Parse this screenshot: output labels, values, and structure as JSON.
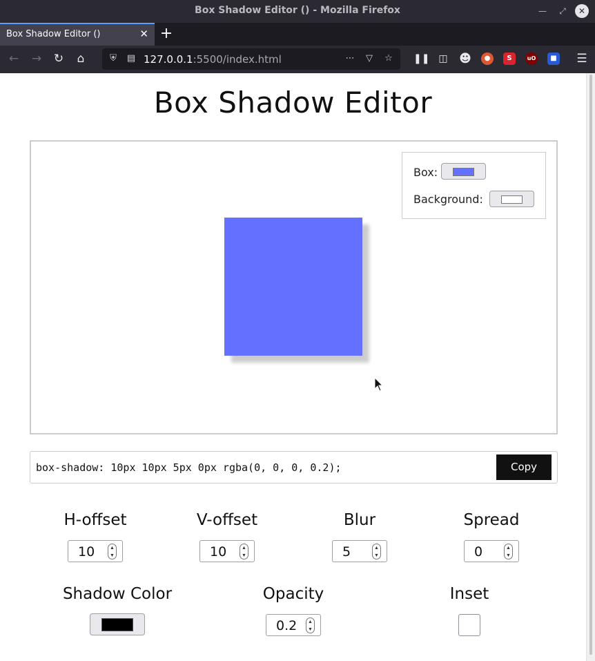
{
  "window": {
    "title": "Box Shadow Editor () - Mozilla Firefox"
  },
  "tab": {
    "label": "Box Shadow Editor ()"
  },
  "address": {
    "host": "127.0.0.1",
    "rest": ":5500/index.html"
  },
  "page": {
    "heading": "Box Shadow Editor",
    "colors_panel": {
      "box_label": "Box:",
      "background_label": "Background:",
      "box_color": "#6470ff",
      "background_color": "#ffffff"
    },
    "code": "box-shadow: 10px 10px 5px 0px rgba(0, 0, 0, 0.2);",
    "copy_label": "Copy",
    "controls": {
      "h_offset": {
        "label": "H-offset",
        "value": "10"
      },
      "v_offset": {
        "label": "V-offset",
        "value": "10"
      },
      "blur": {
        "label": "Blur",
        "value": "5"
      },
      "spread": {
        "label": "Spread",
        "value": "0"
      },
      "shadow_color": {
        "label": "Shadow Color",
        "color": "#000000"
      },
      "opacity": {
        "label": "Opacity",
        "value": "0.2"
      },
      "inset": {
        "label": "Inset",
        "checked": false
      }
    }
  }
}
